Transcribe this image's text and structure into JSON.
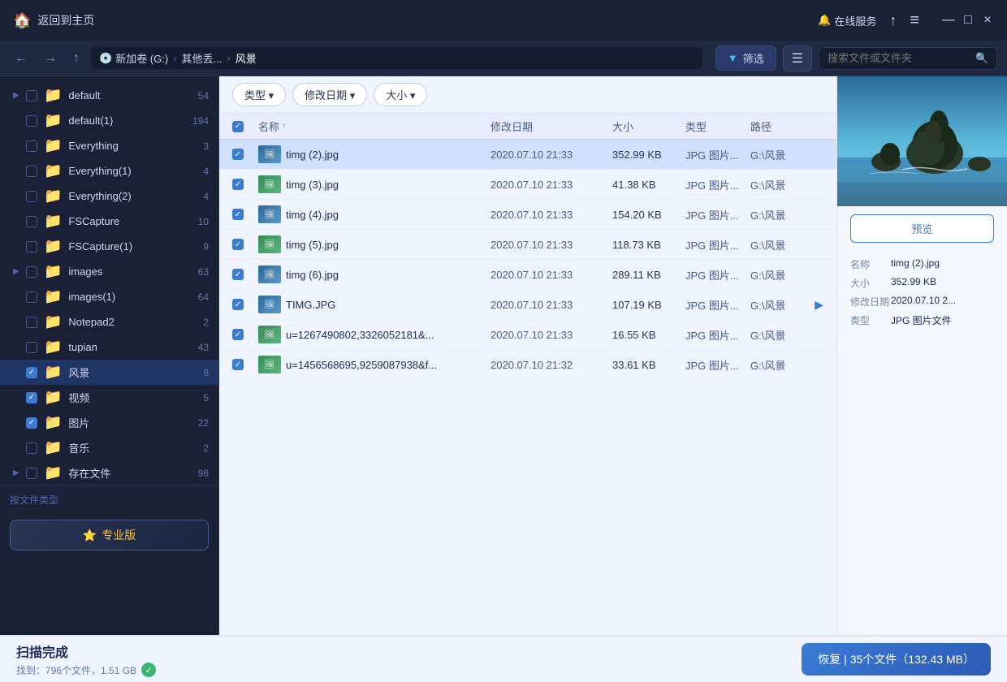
{
  "titlebar": {
    "home_label": "返回到主页",
    "online_service": "在线服务",
    "share_icon": "↑",
    "menu_icon": "≡",
    "min_icon": "—",
    "max_icon": "□",
    "close_icon": "×"
  },
  "navbar": {
    "back_icon": "←",
    "forward_icon": "→",
    "up_icon": "↑",
    "drive_label": "新加卷 (G:)",
    "breadcrumb1": "其他丢...",
    "breadcrumb2": "风景",
    "filter_label": "筛选",
    "search_placeholder": "搜索文件或文件夹"
  },
  "filter_toolbar": {
    "type_label": "类型 ▾",
    "date_label": "修改日期 ▾",
    "size_label": "大小 ▾"
  },
  "table": {
    "col_name": "名称",
    "col_date": "修改日期",
    "col_size": "大小",
    "col_type": "类型",
    "col_path": "路径",
    "rows": [
      {
        "name": "timg (2).jpg",
        "date": "2020.07.10 21:33",
        "size": "352.99 KB",
        "type": "JPG 图片...",
        "path": "G:\\风景",
        "selected": true
      },
      {
        "name": "timg (3).jpg",
        "date": "2020.07.10 21:33",
        "size": "41.38 KB",
        "type": "JPG 图片...",
        "path": "G:\\风景",
        "selected": false
      },
      {
        "name": "timg (4).jpg",
        "date": "2020.07.10 21:33",
        "size": "154.20 KB",
        "type": "JPG 图片...",
        "path": "G:\\风景",
        "selected": false
      },
      {
        "name": "timg (5).jpg",
        "date": "2020.07.10 21:33",
        "size": "118.73 KB",
        "type": "JPG 图片...",
        "path": "G:\\风景",
        "selected": false
      },
      {
        "name": "timg (6).jpg",
        "date": "2020.07.10 21:33",
        "size": "289.11 KB",
        "type": "JPG 图片...",
        "path": "G:\\风景",
        "selected": false
      },
      {
        "name": "TIMG.JPG",
        "date": "2020.07.10 21:33",
        "size": "107.19 KB",
        "type": "JPG 图片...",
        "path": "G:\\风景",
        "selected": false
      },
      {
        "name": "u=1267490802,3326052181&...",
        "date": "2020.07.10 21:33",
        "size": "16.55 KB",
        "type": "JPG 图片...",
        "path": "G:\\风景",
        "selected": false
      },
      {
        "name": "u=1456568695,9259087938&f...",
        "date": "2020.07.10 21:32",
        "size": "33.61 KB",
        "type": "JPG 图片...",
        "path": "G:\\风景",
        "selected": false
      }
    ]
  },
  "sidebar": {
    "items": [
      {
        "name": "default",
        "count": "54",
        "checked": false,
        "has_arrow": true,
        "expanded": false
      },
      {
        "name": "default(1)",
        "count": "194",
        "checked": false,
        "has_arrow": false,
        "expanded": false
      },
      {
        "name": "Everything",
        "count": "3",
        "checked": false,
        "has_arrow": false,
        "expanded": false
      },
      {
        "name": "Everything(1)",
        "count": "4",
        "checked": false,
        "has_arrow": false,
        "expanded": false
      },
      {
        "name": "Everything(2)",
        "count": "4",
        "checked": false,
        "has_arrow": false,
        "expanded": false
      },
      {
        "name": "FSCapture",
        "count": "10",
        "checked": false,
        "has_arrow": false,
        "expanded": false
      },
      {
        "name": "FSCapture(1)",
        "count": "9",
        "checked": false,
        "has_arrow": false,
        "expanded": false
      },
      {
        "name": "images",
        "count": "63",
        "checked": false,
        "has_arrow": true,
        "expanded": false
      },
      {
        "name": "images(1)",
        "count": "64",
        "checked": false,
        "has_arrow": false,
        "expanded": false
      },
      {
        "name": "Notepad2",
        "count": "2",
        "checked": false,
        "has_arrow": false,
        "expanded": false
      },
      {
        "name": "tupian",
        "count": "43",
        "checked": false,
        "has_arrow": false,
        "expanded": false
      },
      {
        "name": "风景",
        "count": "8",
        "checked": true,
        "has_arrow": false,
        "expanded": false,
        "active": true
      },
      {
        "name": "视频",
        "count": "5",
        "checked": true,
        "has_arrow": false,
        "expanded": false
      },
      {
        "name": "图片",
        "count": "22",
        "checked": true,
        "has_arrow": false,
        "expanded": false
      },
      {
        "name": "音乐",
        "count": "2",
        "checked": false,
        "has_arrow": false,
        "expanded": false
      },
      {
        "name": "存在文件",
        "count": "98",
        "checked": false,
        "has_arrow": true,
        "expanded": false
      }
    ],
    "bottom_label": "按文件类型",
    "pro_label": "专业版"
  },
  "right_panel": {
    "preview_label": "预览",
    "info": {
      "name_label": "名称",
      "name_value": "timg (2).jpg",
      "size_label": "大小",
      "size_value": "352.99 KB",
      "date_label": "修改日期",
      "date_value": "2020.07.10 2...",
      "type_label": "类型",
      "type_value": "JPG 图片文件"
    }
  },
  "bottom_bar": {
    "scan_title": "扫描完成",
    "scan_detail": "找到：796个文件，1.51 GB",
    "recover_label": "恢复 | 35个文件（132.43 MB）"
  }
}
